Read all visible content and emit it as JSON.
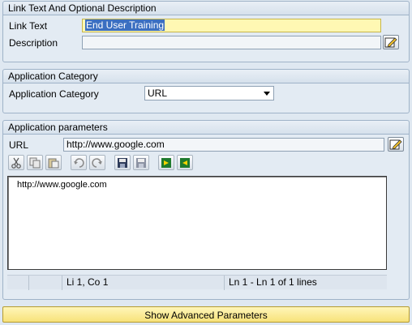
{
  "link_group": {
    "title": "Link Text And Optional Description",
    "link_text_label": "Link Text",
    "link_text_value": "End User Training",
    "description_label": "Description",
    "description_value": ""
  },
  "category_group": {
    "title": "Application Category",
    "category_label": "Application Category",
    "category_value": "URL"
  },
  "params_group": {
    "title": "Application parameters",
    "url_label": "URL",
    "url_value": "http://www.google.com",
    "toolbar_icons": [
      "cut-icon",
      "copy-icon",
      "paste-icon",
      "undo-icon",
      "redo-icon",
      "save-icon",
      "save-as-icon",
      "upload-icon",
      "download-icon"
    ],
    "editor_text": "http://www.google.com",
    "status": {
      "cell1": "",
      "position": "Li 1, Co 1",
      "lines": "Ln 1 - Ln 1 of 1 lines"
    }
  },
  "advanced_button_label": "Show Advanced Parameters",
  "colors": {
    "background": "#dfe8f1",
    "group_border": "#9fb3c8",
    "highlight_field": "#fff8b3",
    "selection": "#3b6fc1",
    "advanced_button": "#f7e27a"
  }
}
